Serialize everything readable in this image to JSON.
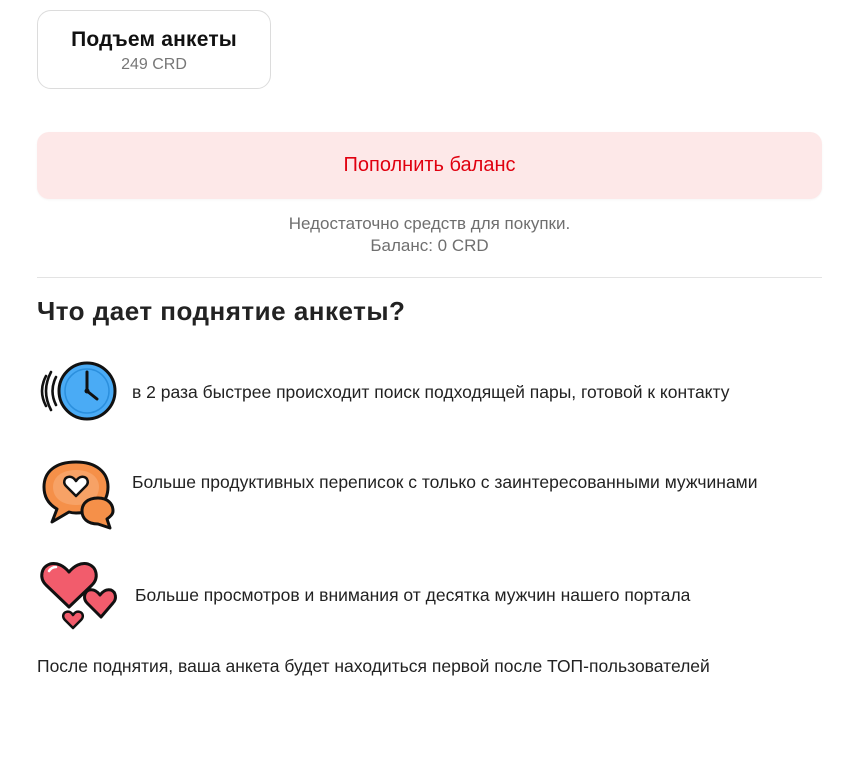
{
  "product": {
    "title": "Подъем анкеты",
    "price": "249 CRD"
  },
  "topup_button": {
    "label": "Пополнить баланс"
  },
  "balance_notice": {
    "line1": "Недостаточно средств для покупки.",
    "line2": "Баланс: 0 CRD"
  },
  "benefits_section": {
    "title": "Что дает поднятие анкеты?",
    "items": [
      {
        "icon": "clock-icon",
        "text": "в 2 раза быстрее происходит поиск подходящей пары, готовой к контакту"
      },
      {
        "icon": "chat-heart-icon",
        "text": "Больше продуктивных переписок с только с заинтересованными мужчинами"
      },
      {
        "icon": "hearts-icon",
        "text": "Больше просмотров и внимания от десятка мужчин нашего портала"
      }
    ]
  },
  "footnote": "После поднятия, ваша анкета будет находиться первой после ТОП-пользователей",
  "colors": {
    "accent_red": "#e0000f",
    "button_bg": "#fde8e8",
    "clock_blue": "#4aabf5",
    "chat_orange": "#f59049",
    "heart_pink": "#f25c6c"
  }
}
